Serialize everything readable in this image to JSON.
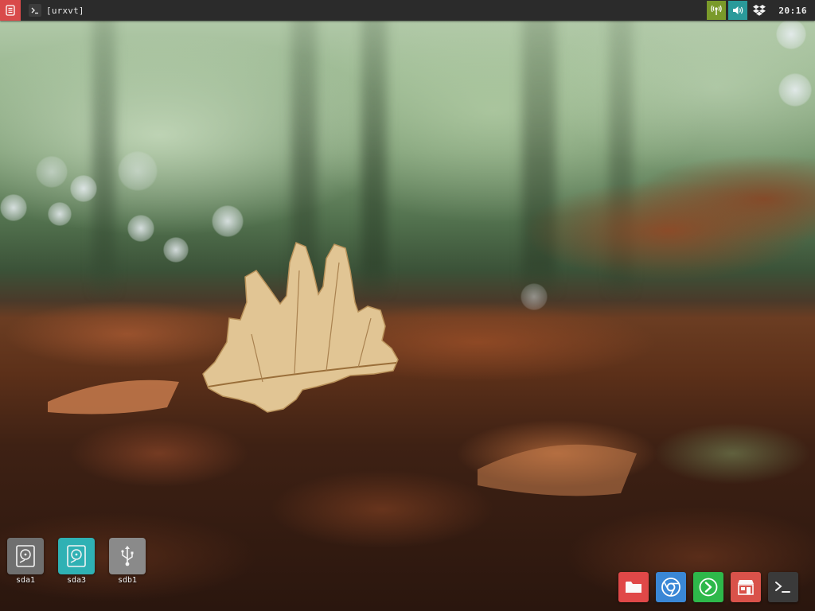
{
  "top_panel": {
    "window_title": "[urxvt]",
    "clock": "20:16",
    "menu_icon": "menu-icon",
    "task_icon": "terminal-icon",
    "tray_icons": [
      "network-icon",
      "volume-icon",
      "dropbox-icon"
    ]
  },
  "devices": [
    {
      "label": "sda1",
      "icon": "hard-disk-icon",
      "color": "#6f6f6f"
    },
    {
      "label": "sda3",
      "icon": "hard-disk-icon",
      "color": "#2fb1b4"
    },
    {
      "label": "sdb1",
      "icon": "usb-icon",
      "color": "#8a8a8a"
    }
  ],
  "dock": [
    {
      "app": "file-manager",
      "icon": "folder-icon",
      "color": "#e04848"
    },
    {
      "app": "chromium",
      "icon": "chromium-icon",
      "color": "#3a87d6"
    },
    {
      "app": "feedreader",
      "icon": "feed-arrow-icon",
      "color": "#2eb84a"
    },
    {
      "app": "package-store",
      "icon": "store-icon",
      "color": "#d9524a"
    },
    {
      "app": "terminal",
      "icon": "terminal-icon",
      "color": "#3a3a3a"
    }
  ],
  "colors": {
    "panel": "#2b2b2b",
    "menu_button": "#d94a4a",
    "network_tray": "#7a9a2a",
    "volume_tray": "#2a9a9a"
  }
}
